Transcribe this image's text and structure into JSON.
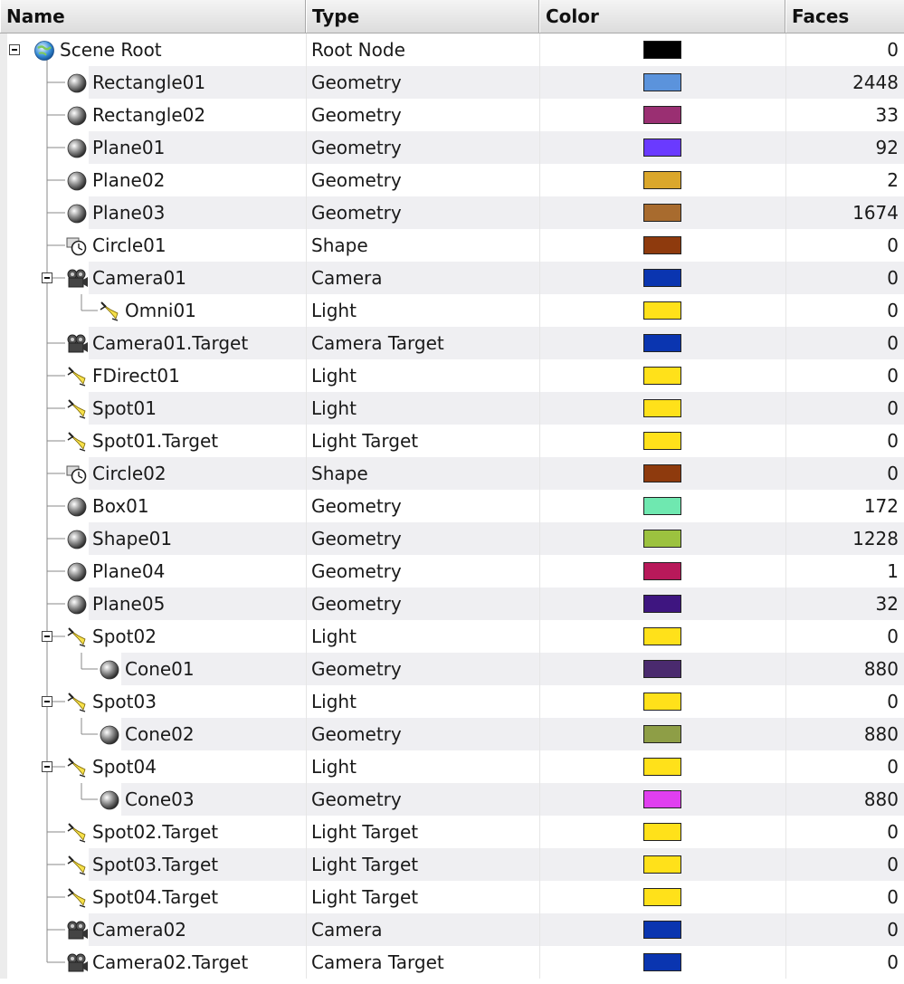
{
  "columns": {
    "name": "Name",
    "type": "Type",
    "color": "Color",
    "faces": "Faces"
  },
  "rows": [
    {
      "name": "Scene Root",
      "type": "Root Node",
      "color": "#000000",
      "faces": "0",
      "depth": 0,
      "icon": "globe-icon",
      "expander": true
    },
    {
      "name": "Rectangle01",
      "type": "Geometry",
      "color": "#5b93dc",
      "faces": "2448",
      "depth": 1,
      "icon": "sphere-icon"
    },
    {
      "name": "Rectangle02",
      "type": "Geometry",
      "color": "#9a2f72",
      "faces": "33",
      "depth": 1,
      "icon": "sphere-icon"
    },
    {
      "name": "Plane01",
      "type": "Geometry",
      "color": "#6a3aff",
      "faces": "92",
      "depth": 1,
      "icon": "sphere-icon"
    },
    {
      "name": "Plane02",
      "type": "Geometry",
      "color": "#dba72b",
      "faces": "2",
      "depth": 1,
      "icon": "sphere-icon"
    },
    {
      "name": "Plane03",
      "type": "Geometry",
      "color": "#a86b2e",
      "faces": "1674",
      "depth": 1,
      "icon": "sphere-icon"
    },
    {
      "name": "Circle01",
      "type": "Shape",
      "color": "#8e3a0d",
      "faces": "0",
      "depth": 1,
      "icon": "shape-icon"
    },
    {
      "name": "Camera01",
      "type": "Camera",
      "color": "#0a35b0",
      "faces": "0",
      "depth": 1,
      "icon": "camera-icon",
      "expander": true
    },
    {
      "name": "Omni01",
      "type": "Light",
      "color": "#ffe11a",
      "faces": "0",
      "depth": 2,
      "icon": "light-icon"
    },
    {
      "name": "Camera01.Target",
      "type": "Camera Target",
      "color": "#0a35b0",
      "faces": "0",
      "depth": 1,
      "icon": "camera-icon"
    },
    {
      "name": "FDirect01",
      "type": "Light",
      "color": "#ffe11a",
      "faces": "0",
      "depth": 1,
      "icon": "light-icon"
    },
    {
      "name": "Spot01",
      "type": "Light",
      "color": "#ffe11a",
      "faces": "0",
      "depth": 1,
      "icon": "light-icon"
    },
    {
      "name": "Spot01.Target",
      "type": "Light Target",
      "color": "#ffe11a",
      "faces": "0",
      "depth": 1,
      "icon": "light-icon"
    },
    {
      "name": "Circle02",
      "type": "Shape",
      "color": "#8e3a0d",
      "faces": "0",
      "depth": 1,
      "icon": "shape-icon"
    },
    {
      "name": "Box01",
      "type": "Geometry",
      "color": "#6fe8b0",
      "faces": "172",
      "depth": 1,
      "icon": "sphere-icon"
    },
    {
      "name": "Shape01",
      "type": "Geometry",
      "color": "#9cc23f",
      "faces": "1228",
      "depth": 1,
      "icon": "sphere-icon"
    },
    {
      "name": "Plane04",
      "type": "Geometry",
      "color": "#b8195a",
      "faces": "1",
      "depth": 1,
      "icon": "sphere-icon"
    },
    {
      "name": "Plane05",
      "type": "Geometry",
      "color": "#3e1580",
      "faces": "32",
      "depth": 1,
      "icon": "sphere-icon"
    },
    {
      "name": "Spot02",
      "type": "Light",
      "color": "#ffe11a",
      "faces": "0",
      "depth": 1,
      "icon": "light-icon",
      "expander": true
    },
    {
      "name": "Cone01",
      "type": "Geometry",
      "color": "#4a2a6e",
      "faces": "880",
      "depth": 2,
      "icon": "sphere-icon"
    },
    {
      "name": "Spot03",
      "type": "Light",
      "color": "#ffe11a",
      "faces": "0",
      "depth": 1,
      "icon": "light-icon",
      "expander": true
    },
    {
      "name": "Cone02",
      "type": "Geometry",
      "color": "#8e9e46",
      "faces": "880",
      "depth": 2,
      "icon": "sphere-icon"
    },
    {
      "name": "Spot04",
      "type": "Light",
      "color": "#ffe11a",
      "faces": "0",
      "depth": 1,
      "icon": "light-icon",
      "expander": true
    },
    {
      "name": "Cone03",
      "type": "Geometry",
      "color": "#e03ff0",
      "faces": "880",
      "depth": 2,
      "icon": "sphere-icon"
    },
    {
      "name": "Spot02.Target",
      "type": "Light Target",
      "color": "#ffe11a",
      "faces": "0",
      "depth": 1,
      "icon": "light-icon"
    },
    {
      "name": "Spot03.Target",
      "type": "Light Target",
      "color": "#ffe11a",
      "faces": "0",
      "depth": 1,
      "icon": "light-icon"
    },
    {
      "name": "Spot04.Target",
      "type": "Light Target",
      "color": "#ffe11a",
      "faces": "0",
      "depth": 1,
      "icon": "light-icon"
    },
    {
      "name": "Camera02",
      "type": "Camera",
      "color": "#0a35b0",
      "faces": "0",
      "depth": 1,
      "icon": "camera-icon"
    },
    {
      "name": "Camera02.Target",
      "type": "Camera Target",
      "color": "#0a35b0",
      "faces": "0",
      "depth": 1,
      "icon": "camera-icon"
    }
  ]
}
